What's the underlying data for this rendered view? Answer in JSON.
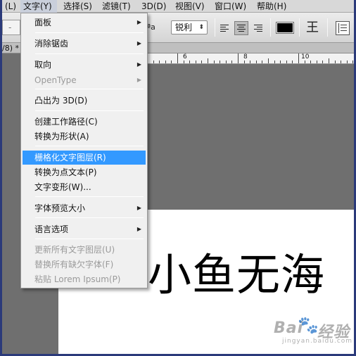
{
  "menubar": {
    "items": [
      {
        "label": "(L)"
      },
      {
        "label": "文字(Y)"
      },
      {
        "label": "选择(S)"
      },
      {
        "label": "滤镜(T)"
      },
      {
        "label": "3D(D)"
      },
      {
        "label": "视图(V)"
      },
      {
        "label": "窗口(W)"
      },
      {
        "label": "帮助(H)"
      }
    ]
  },
  "options_bar": {
    "left_field": "-",
    "aa_label": "ªa",
    "antialias_value": "锐利",
    "text_color": "#000000",
    "warp_icon_glyph": "王"
  },
  "tabbar": {
    "label": "/8) *"
  },
  "ruler": {
    "numbers": [
      "6",
      "8",
      "10",
      "12",
      "14"
    ]
  },
  "menu": {
    "items": [
      {
        "label": "面板",
        "submenu": true,
        "disabled": false
      },
      {
        "label": "消除锯齿",
        "submenu": true,
        "disabled": false
      },
      {
        "label": "取向",
        "submenu": true,
        "disabled": false
      },
      {
        "label": "OpenType",
        "submenu": true,
        "disabled": true
      },
      {
        "label": "凸出为 3D(D)",
        "submenu": false,
        "disabled": false
      },
      {
        "label": "创建工作路径(C)",
        "submenu": false,
        "disabled": false
      },
      {
        "label": "转换为形状(A)",
        "submenu": false,
        "disabled": false
      },
      {
        "label": "栅格化文字图层(R)",
        "submenu": false,
        "disabled": false,
        "highlighted": true
      },
      {
        "label": "转换为点文本(P)",
        "submenu": false,
        "disabled": false
      },
      {
        "label": "文字变形(W)...",
        "submenu": false,
        "disabled": false
      },
      {
        "label": "字体预览大小",
        "submenu": true,
        "disabled": false
      },
      {
        "label": "语言选项",
        "submenu": true,
        "disabled": false
      },
      {
        "label": "更新所有文字图层(U)",
        "submenu": false,
        "disabled": true
      },
      {
        "label": "替换所有缺欠字体(F)",
        "submenu": false,
        "disabled": true
      },
      {
        "label": "粘贴 Lorem Ipsum(P)",
        "submenu": false,
        "disabled": true
      }
    ],
    "submenu_glyph": "▶",
    "highlight_color": "#3399ff"
  },
  "canvas": {
    "text": "小鱼无海"
  },
  "watermark": {
    "logo": "Bai",
    "logo2": "经验",
    "sub": "jingyan.baidu.com",
    "paw": "🐾"
  }
}
